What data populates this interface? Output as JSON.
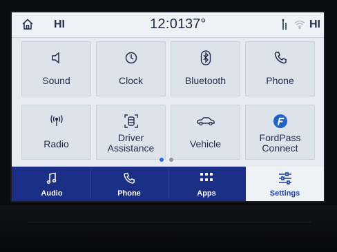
{
  "status_bar": {
    "left_label": "HI",
    "time": "12:01",
    "temperature": "37°",
    "right_label": "HI"
  },
  "tiles": [
    {
      "label": "Sound",
      "icon": "speaker-icon"
    },
    {
      "label": "Clock",
      "icon": "clock-icon"
    },
    {
      "label": "Bluetooth",
      "icon": "bluetooth-icon"
    },
    {
      "label": "Phone",
      "icon": "phone-icon"
    },
    {
      "label": "Radio",
      "icon": "radio-antenna-icon"
    },
    {
      "label_line1": "Driver",
      "label_line2": "Assistance",
      "icon": "driver-assist-icon"
    },
    {
      "label": "Vehicle",
      "icon": "car-icon"
    },
    {
      "label_line1": "FordPass",
      "label_line2": "Connect",
      "icon": "fordpass-logo-icon"
    }
  ],
  "pager": {
    "pages": 2,
    "current": 1
  },
  "bottom_nav": [
    {
      "label": "Audio",
      "icon": "music-note-icon",
      "active": false
    },
    {
      "label": "Phone",
      "icon": "phone-icon",
      "active": false
    },
    {
      "label": "Apps",
      "icon": "apps-grid-icon",
      "active": false
    },
    {
      "label": "Settings",
      "icon": "settings-sliders-icon",
      "active": true
    }
  ],
  "colors": {
    "screen_bg": "#e8ecf2",
    "tile_bg": "#dde3ea",
    "nav_bg": "#1b2f86",
    "active_tab_bg": "#eef1f6",
    "accent": "#1b3fa8",
    "pager_active": "#2a6ad8",
    "pager_inactive": "#8b97ad"
  }
}
